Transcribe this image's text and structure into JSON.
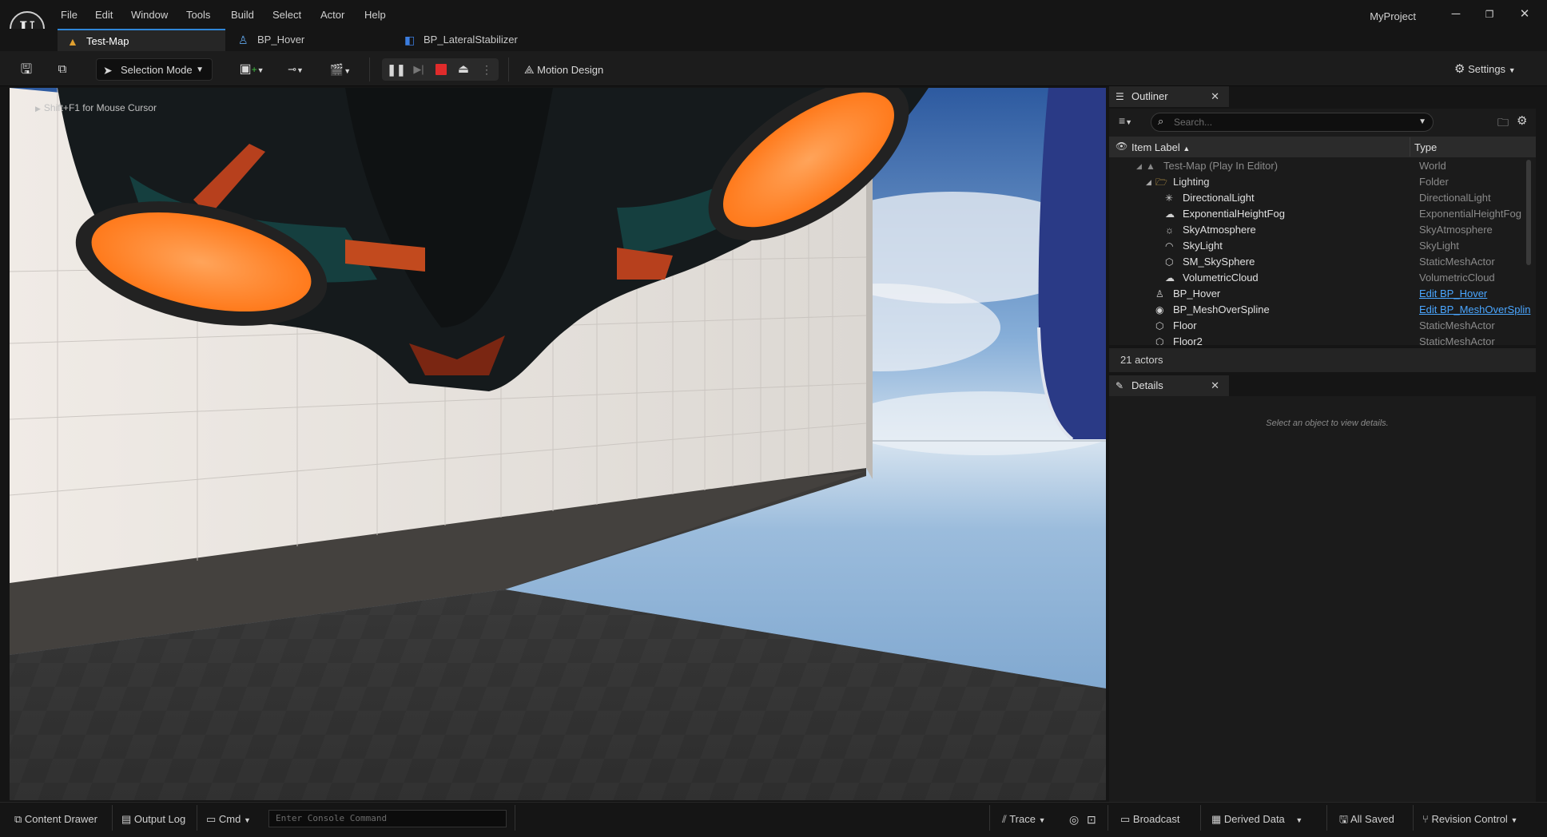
{
  "app": {
    "project_name": "MyProject",
    "logo_text": "U"
  },
  "menu": [
    "File",
    "Edit",
    "Window",
    "Tools",
    "Build",
    "Select",
    "Actor",
    "Help"
  ],
  "tabs": [
    {
      "label": "Test-Map",
      "icon": "map-icon",
      "active": true
    },
    {
      "label": "BP_Hover",
      "icon": "blueprint-actor-icon",
      "active": false
    },
    {
      "label": "BP_LateralStabilizer",
      "icon": "blueprint-component-icon",
      "active": false
    }
  ],
  "toolbar": {
    "selection_mode": "Selection Mode",
    "motion_design": "Motion Design",
    "settings": "Settings"
  },
  "viewport": {
    "hint": "Shift+F1 for Mouse Cursor"
  },
  "outliner": {
    "title": "Outliner",
    "search_placeholder": "Search...",
    "col_label": "Item Label",
    "col_type": "Type",
    "rows": [
      {
        "label": "Test-Map (Play In Editor)",
        "type": "World",
        "icon": "world-icon",
        "dim": true,
        "link": false
      },
      {
        "label": "Lighting",
        "type": "Folder",
        "icon": "folder-icon",
        "dim": false,
        "link": false
      },
      {
        "label": "DirectionalLight",
        "type": "DirectionalLight",
        "icon": "sun-icon",
        "dim": false,
        "link": false
      },
      {
        "label": "ExponentialHeightFog",
        "type": "ExponentialHeightFog",
        "icon": "fog-icon",
        "dim": false,
        "link": false
      },
      {
        "label": "SkyAtmosphere",
        "type": "SkyAtmosphere",
        "icon": "atmosphere-icon",
        "dim": false,
        "link": false
      },
      {
        "label": "SkyLight",
        "type": "SkyLight",
        "icon": "skylight-icon",
        "dim": false,
        "link": false
      },
      {
        "label": "SM_SkySphere",
        "type": "StaticMeshActor",
        "icon": "mesh-icon",
        "dim": false,
        "link": false
      },
      {
        "label": "VolumetricCloud",
        "type": "VolumetricCloud",
        "icon": "cloud-icon",
        "dim": false,
        "link": false
      },
      {
        "label": "BP_Hover",
        "type": "Edit BP_Hover",
        "icon": "pawn-icon",
        "dim": false,
        "link": true
      },
      {
        "label": "BP_MeshOverSpline",
        "type": "Edit BP_MeshOverSplin",
        "icon": "actor-icon",
        "dim": false,
        "link": true
      },
      {
        "label": "Floor",
        "type": "StaticMeshActor",
        "icon": "mesh-icon",
        "dim": false,
        "link": false
      },
      {
        "label": "Floor2",
        "type": "StaticMeshActor",
        "icon": "mesh-icon",
        "dim": false,
        "link": false
      }
    ],
    "actor_count": "21 actors"
  },
  "details": {
    "title": "Details",
    "hint": "Select an object to view details."
  },
  "statusbar": {
    "content_drawer": "Content Drawer",
    "output_log": "Output Log",
    "cmd": "Cmd",
    "console_placeholder": "Enter Console Command",
    "trace": "Trace",
    "broadcast": "Broadcast",
    "derived_data": "Derived Data",
    "all_saved": "All Saved",
    "revision_control": "Revision Control"
  },
  "colors": {
    "accent": "#2f86d7",
    "link": "#4aa6ff",
    "stop": "#e02b2b"
  }
}
